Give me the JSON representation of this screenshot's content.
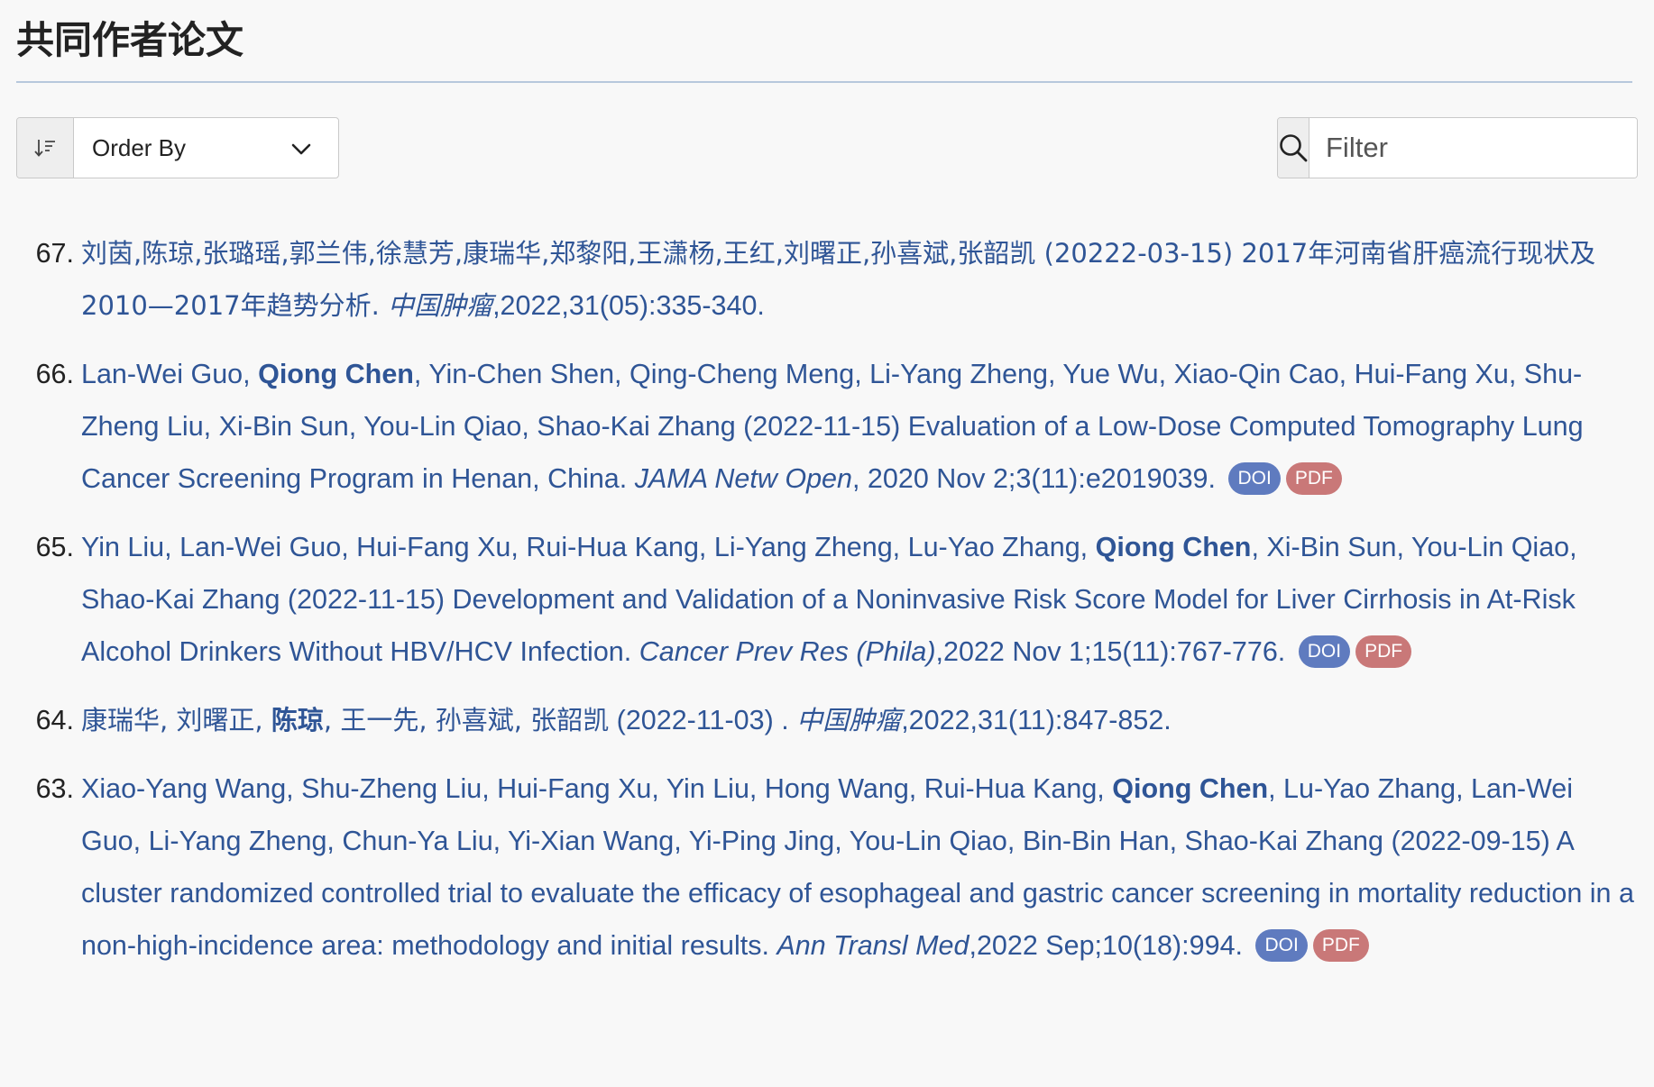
{
  "page": {
    "title": "共同作者论文"
  },
  "toolbar": {
    "order_icon": "sort-descending-icon",
    "order_label": "Order By",
    "order_chevron": "chevron-down-icon",
    "search_icon": "search-icon",
    "filter_placeholder": "Filter"
  },
  "colors": {
    "link": "#2f5596",
    "doi_badge": "#5f7bbf",
    "pdf_badge": "#c97878",
    "title_rule": "#b7c8dc"
  },
  "publications": [
    {
      "num": "67.",
      "authors_before": "刘茵,陈琼,张璐瑶,郭兰伟,徐慧芳,康瑞华,郑黎阳,王潇杨,王红,刘曙正,孙喜斌,张韶凯",
      "highlight": "",
      "authors_after": "",
      "date_title": " (20222-03-15) 2017年河南省肝癌流行现状及2010—2017年趋势分析. ",
      "journal": "中国肿瘤",
      "citation": ",2022,31(05):335-340.",
      "doi": "",
      "pdf": ""
    },
    {
      "num": "66.",
      "authors_before": "Lan-Wei Guo, ",
      "highlight": "Qiong Chen",
      "authors_after": ", Yin-Chen Shen, Qing-Cheng Meng, Li-Yang Zheng, Yue Wu, Xiao-Qin Cao, Hui-Fang Xu, Shu-Zheng Liu, Xi-Bin Sun, You-Lin Qiao, Shao-Kai Zhang",
      "date_title": " (2022-11-15) Evaluation of a Low-Dose Computed Tomography Lung Cancer Screening Program in Henan, China. ",
      "journal": "JAMA Netw Open",
      "citation": ", 2020 Nov 2;3(11):e2019039. ",
      "doi": "DOI",
      "pdf": "PDF"
    },
    {
      "num": "65.",
      "authors_before": "Yin Liu, Lan-Wei Guo, Hui-Fang Xu, Rui-Hua Kang, Li-Yang Zheng, Lu-Yao Zhang, ",
      "highlight": "Qiong Chen",
      "authors_after": ", Xi-Bin Sun, You-Lin Qiao, Shao-Kai Zhang",
      "date_title": " (2022-11-15) Development and Validation of a Noninvasive Risk Score Model for Liver Cirrhosis in At-Risk Alcohol Drinkers Without HBV/HCV Infection. ",
      "journal": "Cancer Prev Res (Phila)",
      "citation": ",2022 Nov 1;15(11):767-776. ",
      "doi": "DOI",
      "pdf": "PDF"
    },
    {
      "num": "64.",
      "authors_before": "康瑞华, 刘曙正, ",
      "highlight": "陈琼",
      "authors_after": ", 王一先, 孙喜斌, 张韶凯",
      "date_title": " (2022-11-03) . ",
      "journal": "中国肿瘤",
      "citation": ",2022,31(11):847-852.",
      "doi": "",
      "pdf": ""
    },
    {
      "num": "63.",
      "authors_before": "Xiao-Yang Wang, Shu-Zheng Liu, Hui-Fang Xu, Yin Liu, Hong Wang, Rui-Hua Kang, ",
      "highlight": "Qiong Chen",
      "authors_after": ", Lu-Yao Zhang, Lan-Wei Guo, Li-Yang Zheng, Chun-Ya Liu, Yi-Xian Wang, Yi-Ping Jing, You-Lin Qiao, Bin-Bin Han, Shao-Kai Zhang",
      "date_title": " (2022-09-15) A cluster randomized controlled trial to evaluate the efficacy of esophageal and gastric cancer screening in mortality reduction in a non-high-incidence area: methodology and initial results. ",
      "journal": "Ann Transl Med",
      "citation": ",2022 Sep;10(18):994. ",
      "doi": "DOI",
      "pdf": "PDF"
    }
  ]
}
